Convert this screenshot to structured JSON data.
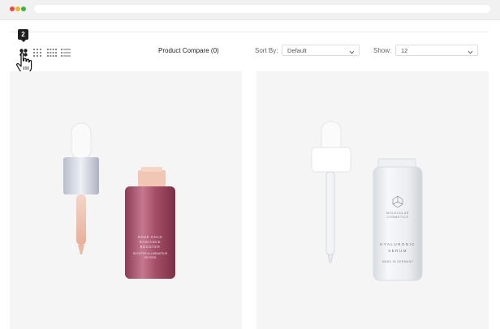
{
  "toolbar": {
    "view_tooltip": "2",
    "compare_label": "Product Compare (0)",
    "sort_label": "Sort By:",
    "sort_value": "Default",
    "show_label": "Show:",
    "show_value": "12"
  },
  "icons": {
    "view_2": "grid-2-icon",
    "view_3": "grid-3-icon",
    "view_4": "grid-4-icon",
    "view_list": "list-view-icon",
    "cursor": "pointer-hand-icon",
    "caret": "chevron-down-icon"
  },
  "products": [
    {
      "label_lines": [
        "ROSE GOLD",
        "RADIANCE",
        "BOOSTER",
        "BOOSTER ILLUMINATEUR",
        "OR ROSE"
      ]
    },
    {
      "label_lines": [
        "MOLECULAR",
        "COSMETICS",
        "HYALURONIC",
        "SERUM",
        "MADE IN GERMANY"
      ]
    }
  ],
  "colors": {
    "card_bg": "#f6f5f6",
    "bottle_pink": "#b05a72",
    "dropper_silver": "#d7d9e2",
    "tooltip_bg": "#1f1f1f"
  }
}
